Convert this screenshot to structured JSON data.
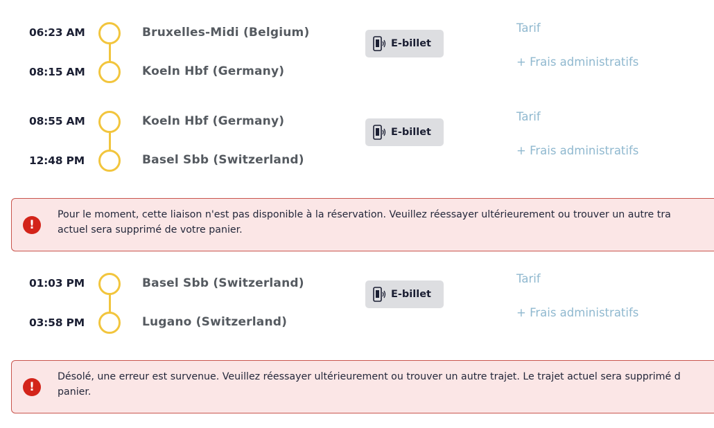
{
  "segments": [
    {
      "dep_time": "06:23 AM",
      "dep_station": "Bruxelles-Midi (Belgium)",
      "arr_time": "08:15 AM",
      "arr_station": "Koeln Hbf (Germany)",
      "ticket_label": "E-billet",
      "tarif_label": "Tarif",
      "frais_label": "+ Frais administratifs"
    },
    {
      "dep_time": "08:55 AM",
      "dep_station": "Koeln Hbf (Germany)",
      "arr_time": "12:48 PM",
      "arr_station": "Basel Sbb (Switzerland)",
      "ticket_label": "E-billet",
      "tarif_label": "Tarif",
      "frais_label": "+ Frais administratifs"
    },
    {
      "dep_time": "01:03 PM",
      "dep_station": "Basel Sbb (Switzerland)",
      "arr_time": "03:58 PM",
      "arr_station": "Lugano (Switzerland)",
      "ticket_label": "E-billet",
      "tarif_label": "Tarif",
      "frais_label": "+ Frais administratifs"
    }
  ],
  "alerts": [
    {
      "icon": "!",
      "line1": "Pour le moment, cette liaison n'est pas disponible à la réservation. Veuillez réessayer ultérieurement ou trouver un autre tra",
      "line2": "actuel sera supprimé de votre panier."
    },
    {
      "icon": "!",
      "line1": "Désolé, une erreur est survenue. Veuillez réessayer ultérieurement ou trouver un autre trajet. Le trajet actuel sera supprimé d",
      "line2": "panier."
    }
  ],
  "colors": {
    "timeline": "#f2c53d",
    "alert_bg": "#fbe6e6",
    "alert_border": "#c9544c",
    "alert_icon": "#d3241a",
    "link": "#8fb8cf",
    "badge_bg": "#dddee1"
  },
  "icons": {
    "ticket": "phone-ticket-icon",
    "alert": "error-circle-icon"
  }
}
